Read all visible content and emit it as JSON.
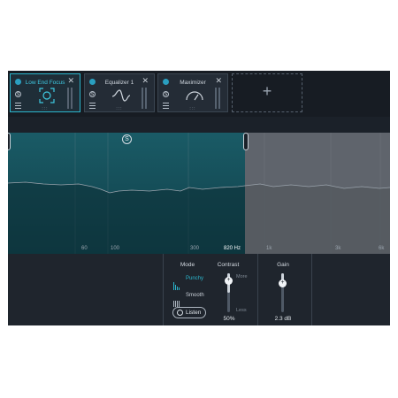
{
  "modules": [
    {
      "title": "Low End Focus",
      "active": true,
      "icon": "low-end-focus-icon"
    },
    {
      "title": "Equalizer 1",
      "active": false,
      "icon": "eq-curve-icon"
    },
    {
      "title": "Maximizer",
      "active": false,
      "icon": "gauge-icon"
    }
  ],
  "module_strip": {
    "add_label": "+",
    "solo_label": "S",
    "close_label": "✕",
    "dots_label": ":::"
  },
  "graph": {
    "solo_badge": "S",
    "freq_labels": [
      "60",
      "100",
      "300",
      "1k",
      "3k",
      "6k"
    ],
    "crossover_freq": "820 Hz"
  },
  "controls": {
    "mode": {
      "heading": "Mode",
      "options": [
        "Punchy",
        "Smooth"
      ],
      "selected": "Punchy"
    },
    "listen_label": "Listen",
    "contrast": {
      "heading": "Contrast",
      "more_label": "More",
      "less_label": "Less",
      "value": "50%",
      "level": 0.5
    },
    "gain": {
      "heading": "Gain",
      "value": "2.3 dB",
      "level": 0.35
    },
    "knob_symbol": "+"
  },
  "colors": {
    "accent": "#2bb5cc",
    "band": "#164f5a",
    "background": "#1b2129"
  }
}
